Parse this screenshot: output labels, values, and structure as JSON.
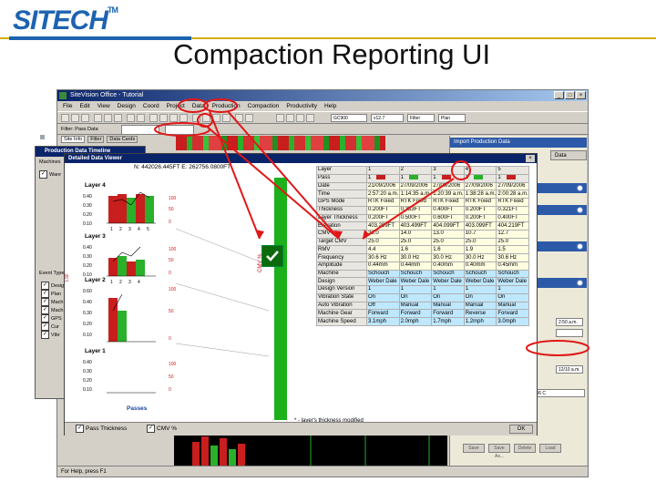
{
  "brand": {
    "logo": "SITECH",
    "tm": "TM"
  },
  "slide": {
    "title": "Compaction Reporting UI"
  },
  "app": {
    "title": "SiteVision Office - Tutorial",
    "menu": [
      "File",
      "Edit",
      "View",
      "Design",
      "Coord",
      "Project",
      "Data",
      "Production",
      "Compaction",
      "Productivity",
      "Help"
    ],
    "toolbar": {
      "combo1": "GC900",
      "combo2": "v12.7",
      "combo3": "Filter",
      "combo4": "Plan",
      "filter_label": "Filter: Pass Data"
    },
    "tabs": [
      "Site Info",
      "Filter",
      "Data Cards"
    ],
    "status": "For Help, press F1"
  },
  "right_panel": {
    "header1": "Import Production Data",
    "header2": "Data",
    "date_combo": "12/09/2006 C",
    "time_combo": "12/10 a.m.",
    "time_combo2": "2:50 a.m.",
    "buttons": [
      "Save",
      "Save As...",
      "Delete",
      "Load"
    ]
  },
  "timeline": {
    "title": "Production Data Timeline",
    "machines_label": "Machines",
    "ware_label": "Ware",
    "event_label": "Event Type",
    "items": [
      "Desig",
      "Plan",
      "Mach",
      "Mach",
      "GPS",
      "Cur",
      "Vibr"
    ]
  },
  "viewer": {
    "title": "Detailed Data Viewer",
    "coords": "N: 442026.445FT  E: 262756.0800FT",
    "cmv_axis": "CMV %",
    "lsf_axis": "LSF",
    "passes_label": "Passes",
    "layers": [
      {
        "name": "Layer 4",
        "y_ticks": [
          "0.40",
          "0.30",
          "0.20",
          "0.10"
        ],
        "cmv_ticks": [
          "100",
          "50",
          "0"
        ],
        "x_ticks": [
          "1",
          "2",
          "3",
          "4",
          "5"
        ]
      },
      {
        "name": "Layer 3",
        "y_ticks": [
          "0.40",
          "0.30",
          "0.20",
          "0.10"
        ],
        "cmv_ticks": [
          "100",
          "50",
          "0"
        ],
        "x_ticks": [
          "1",
          "2",
          "3",
          "4"
        ]
      },
      {
        "name": "Layer 2",
        "y_ticks": [
          "0.60",
          "0.40",
          "0.30",
          "0.20",
          "0.10"
        ],
        "cmv_ticks": [
          "100",
          "50",
          "0"
        ],
        "x_ticks": []
      },
      {
        "name": "Layer 1",
        "y_ticks": [
          "0.40",
          "0.30",
          "0.20",
          "0.10"
        ],
        "cmv_ticks": [
          "100",
          "50",
          "0"
        ],
        "x_ticks": []
      }
    ],
    "bottom": {
      "chk1": "Pass Thickness",
      "chk2": "CMV %",
      "ok": "OK"
    },
    "footnote": "* - layer's thickness modified",
    "table": {
      "rows": [
        {
          "label": "Layer",
          "values": [
            "1",
            "2",
            "3",
            "4",
            "5"
          ],
          "style": "hdr"
        },
        {
          "label": "Pass",
          "values": [
            "1",
            "1",
            "1",
            "1",
            "1"
          ],
          "style": "hdr",
          "swatches": [
            "r",
            "g",
            "r",
            "g",
            "r"
          ]
        },
        {
          "label": "Date",
          "values": [
            "21/09/2006",
            "27/09/2006",
            "27/09/2006",
            "27/09/2006",
            "27/09/2006"
          ]
        },
        {
          "label": "Time",
          "values": [
            "2:57:20 a.m.",
            "1:14:35 a.m.",
            "1:20:39 a.m.",
            "1:38:28 a.m.",
            "2:00:28 a.m."
          ]
        },
        {
          "label": "GPS Mode",
          "values": [
            "RTK Fixed",
            "RTK Fixed",
            "RTK Fixed",
            "RTK Fixed",
            "RTK Fixed"
          ]
        },
        {
          "label": "Thickness",
          "values": [
            "0.200FT",
            "0.333FT",
            "0.400FT",
            "0.200FT",
            "0.321FT"
          ]
        },
        {
          "label": "Layer Thickness",
          "values": [
            "0.200FT",
            "0.500FT",
            "0.600FT",
            "0.200FT",
            "0.400FT"
          ]
        },
        {
          "label": "Elevation",
          "values": [
            "403.299FT",
            "403.499FT",
            "404.099FT",
            "403.099FT",
            "404.219FT"
          ]
        },
        {
          "label": "CMV",
          "values": [
            "33.0",
            "14.0",
            "13.0",
            "10.7",
            "12.7"
          ]
        },
        {
          "label": "Target CMV",
          "values": [
            "25.0",
            "25.0",
            "25.0",
            "25.0",
            "25.0"
          ]
        },
        {
          "label": "RMV",
          "values": [
            "4.4",
            "1.6",
            "1.6",
            "1.9",
            "1.5"
          ]
        },
        {
          "label": "Frequency",
          "values": [
            "30.6 Hz",
            "30.0 Hz",
            "30.0 Hz",
            "30.0 Hz",
            "30.6 Hz"
          ]
        },
        {
          "label": "Amplitude",
          "values": [
            "0.44mm",
            "0.44mm",
            "0.40mm",
            "0.40mm",
            "0.45mm"
          ]
        },
        {
          "label": "Machine",
          "values": [
            "Schouch",
            "Schouch",
            "Schouch",
            "Schouch",
            "Schouch"
          ],
          "style": "blue"
        },
        {
          "label": "Design",
          "values": [
            "Weber Dale",
            "Weber Dale",
            "Weber Dale",
            "Weber Dale",
            "Weber Dale"
          ],
          "style": "blue"
        },
        {
          "label": "Design Version",
          "values": [
            "1",
            "1",
            "1",
            "1",
            "1"
          ],
          "style": "blue"
        },
        {
          "label": "Vibration State",
          "values": [
            "On",
            "On",
            "On",
            "On",
            "On"
          ],
          "style": "blue"
        },
        {
          "label": "Auto Vibration",
          "values": [
            "Off",
            "Manual",
            "Manual",
            "Manual",
            "Manual"
          ],
          "style": "blue"
        },
        {
          "label": "Machine Gear",
          "values": [
            "Forward",
            "Forward",
            "Forward",
            "Reverse",
            "Forward"
          ],
          "style": "blue"
        },
        {
          "label": "Machine Speed",
          "values": [
            "3.1mph",
            "2.0mph",
            "1.7mph",
            "1.2mph",
            "3.0mph"
          ],
          "style": "blue"
        }
      ]
    }
  },
  "colors": {
    "brand": "#1d63b0",
    "accent": "#d4b000",
    "annotation": "#e01818",
    "cmv_bar": "#2ab02a",
    "pass_bar": "#c81e1e"
  }
}
